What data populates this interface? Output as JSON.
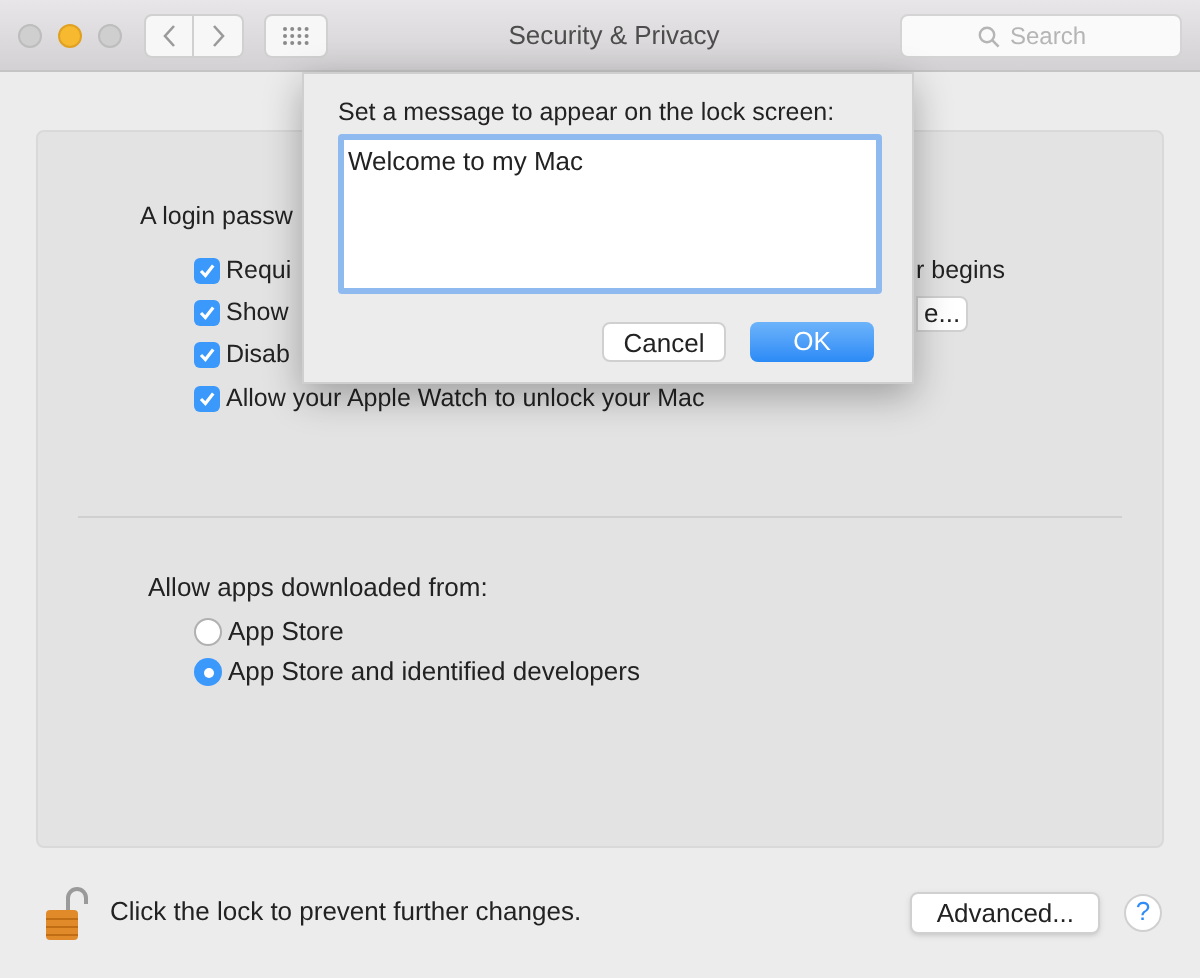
{
  "window": {
    "title": "Security & Privacy"
  },
  "search": {
    "placeholder": "Search"
  },
  "login": {
    "heading": "A login passw",
    "options": [
      {
        "label": "Requi",
        "right_text": "r begins",
        "checked": true
      },
      {
        "label": "Show",
        "right_button": "e...",
        "checked": true
      },
      {
        "label": "Disab",
        "checked": true
      },
      {
        "label": "Allow your Apple Watch to unlock your Mac",
        "checked": true
      }
    ]
  },
  "apps": {
    "heading": "Allow apps downloaded from:",
    "options": [
      {
        "label": "App Store",
        "selected": false
      },
      {
        "label": "App Store and identified developers",
        "selected": true
      }
    ]
  },
  "footer": {
    "lock_text": "Click the lock to prevent further changes.",
    "advanced_button": "Advanced...",
    "help": "?"
  },
  "dialog": {
    "prompt": "Set a message to appear on the lock screen:",
    "value": "Welcome to my Mac",
    "buttons": [
      {
        "label": "Cancel",
        "default": false
      },
      {
        "label": "OK",
        "default": true
      }
    ]
  }
}
